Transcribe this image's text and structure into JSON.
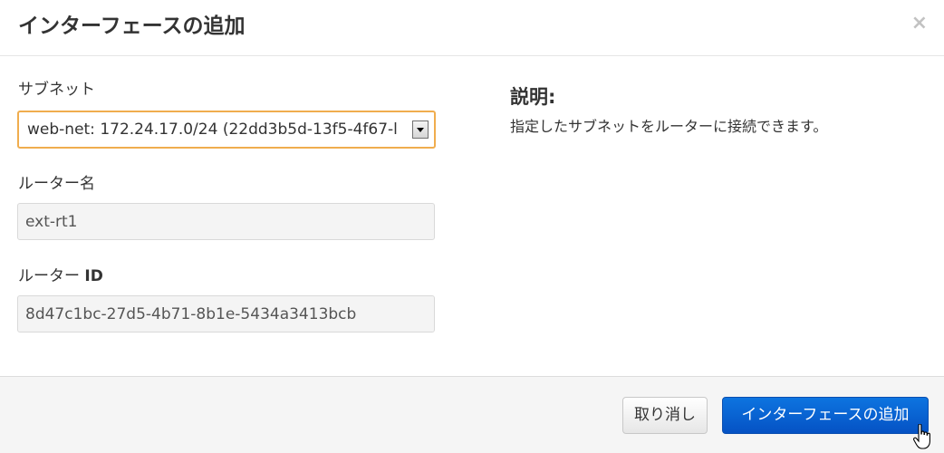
{
  "dialog": {
    "title": "インターフェースの追加",
    "close_symbol": "×"
  },
  "form": {
    "subnet": {
      "label": "サブネット",
      "selected_value": "web-net: 172.24.17.0/24 (22dd3b5d-13f5-4f67-l"
    },
    "router_name": {
      "label": "ルーター名",
      "value": "ext-rt1"
    },
    "router_id": {
      "label_prefix": "ルーター ",
      "label_suffix": "ID",
      "value": "8d47c1bc-27d5-4b71-8b1e-5434a3413bcb"
    }
  },
  "description": {
    "title": "説明:",
    "text": "指定したサブネットをルーターに接続できます。"
  },
  "footer": {
    "cancel_label": "取り消し",
    "submit_label": "インターフェースの追加"
  },
  "colors": {
    "primary": "#0552c4",
    "focus_border": "#f0ad4e",
    "footer_bg": "#f5f5f5"
  },
  "icons": {
    "close": "close-icon",
    "dropdown": "dropdown-arrow-icon",
    "cursor": "hand-pointer-icon"
  }
}
